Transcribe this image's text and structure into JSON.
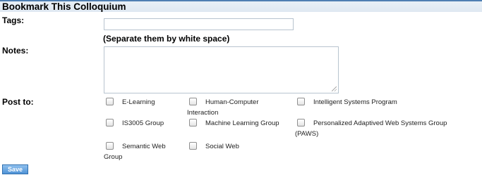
{
  "header": {
    "title": "Bookmark This Colloquium"
  },
  "tags": {
    "label": "Tags:",
    "value": "",
    "hint": "(Separate them by white space)"
  },
  "notes": {
    "label": "Notes:",
    "value": ""
  },
  "post_to": {
    "label": "Post to:",
    "groups": [
      {
        "line1": "E-Learning",
        "line2": ""
      },
      {
        "line1": "Human-Computer",
        "line2": "Interaction"
      },
      {
        "line1": "Intelligent Systems Program",
        "line2": ""
      },
      {
        "line1": "IS3005 Group",
        "line2": ""
      },
      {
        "line1": "Machine Learning Group",
        "line2": ""
      },
      {
        "line1": "Personalized Adaptived Web Systems Group",
        "line2": "(PAWS)"
      },
      {
        "line1": "Semantic Web",
        "line2": "Group"
      },
      {
        "line1": "Social Web",
        "line2": ""
      }
    ]
  },
  "save_label": "Save"
}
